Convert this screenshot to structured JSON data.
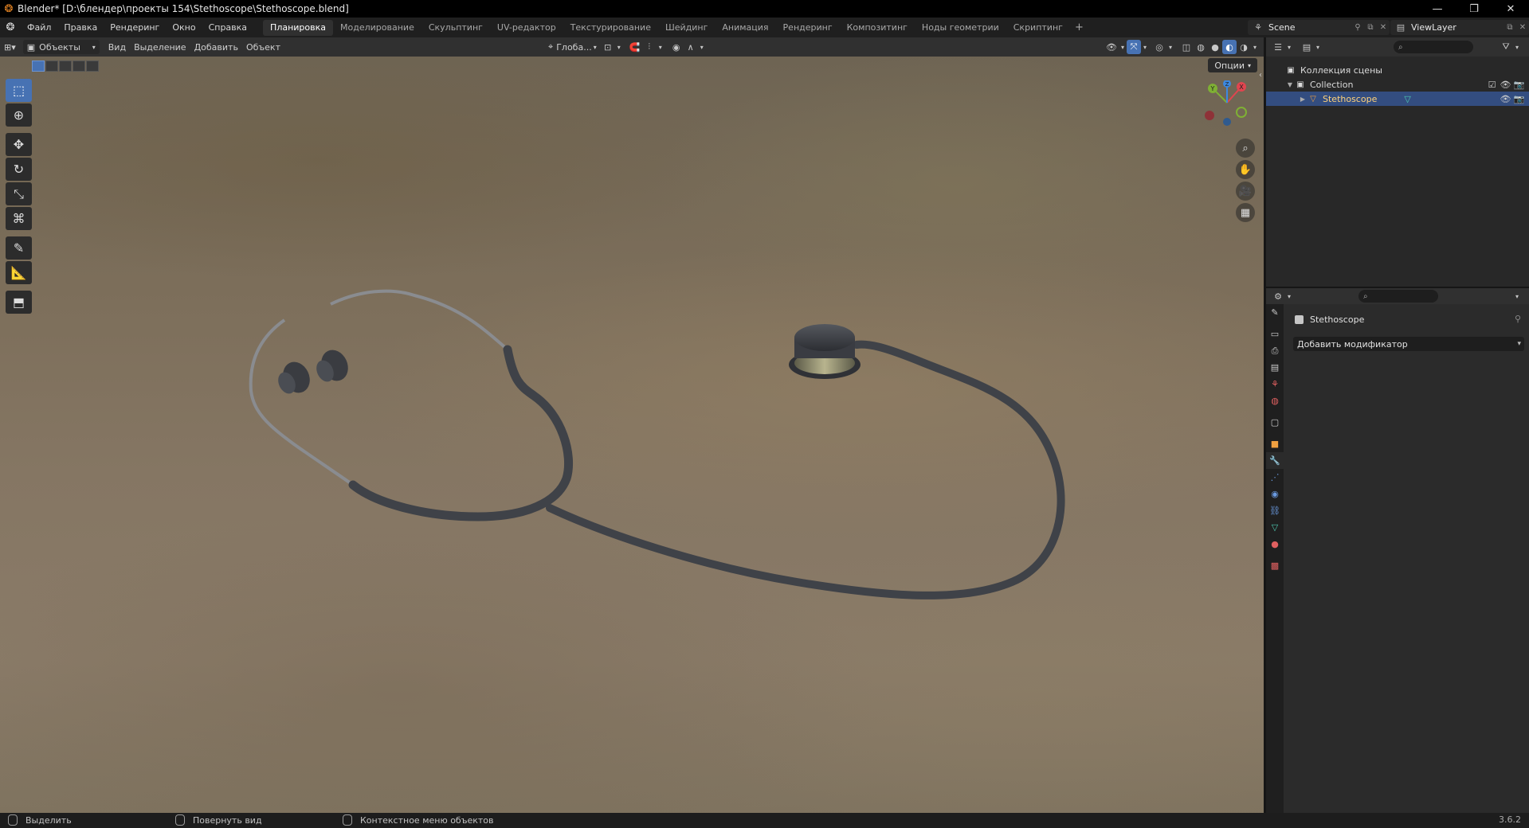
{
  "window": {
    "title": "Blender* [D:\\блендер\\проекты 154\\Stethoscope\\Stethoscope.blend]",
    "minimize": "—",
    "maximize": "❐",
    "close": "✕"
  },
  "menu": {
    "file": "Файл",
    "edit": "Правка",
    "render": "Рендеринг",
    "window": "Окно",
    "help": "Справка"
  },
  "workspaces": [
    {
      "label": "Планировка",
      "active": true
    },
    {
      "label": "Моделирование"
    },
    {
      "label": "Скульптинг"
    },
    {
      "label": "UV-редактор"
    },
    {
      "label": "Текстурирование"
    },
    {
      "label": "Шейдинг"
    },
    {
      "label": "Анимация"
    },
    {
      "label": "Рендеринг"
    },
    {
      "label": "Композитинг"
    },
    {
      "label": "Ноды геометрии"
    },
    {
      "label": "Скриптинг"
    }
  ],
  "scene": {
    "name": "Scene"
  },
  "viewlayer": {
    "name": "ViewLayer"
  },
  "viewport_header": {
    "mode": "Объекты",
    "view": "Вид",
    "select": "Выделение",
    "add": "Добавить",
    "object": "Объект",
    "transform_orientation": "Глоба...",
    "options": "Опции"
  },
  "gizmo": {
    "x": "X",
    "y": "Y",
    "z": "Z"
  },
  "outliner": {
    "scene_collection": "Коллекция сцены",
    "collection": "Collection",
    "object": "Stethoscope"
  },
  "properties": {
    "object_name": "Stethoscope",
    "add_modifier": "Добавить модификатор"
  },
  "statusbar": {
    "select": "Выделить",
    "rotate": "Повернуть вид",
    "context_menu": "Контекстное меню объектов",
    "version": "3.6.2"
  },
  "colors": {
    "accent": "#4772b3",
    "selected_row": "#334d80",
    "axis_x": "#e0454f",
    "axis_y": "#7fb034",
    "axis_z": "#3c88e0",
    "tube": "#3f4248"
  }
}
